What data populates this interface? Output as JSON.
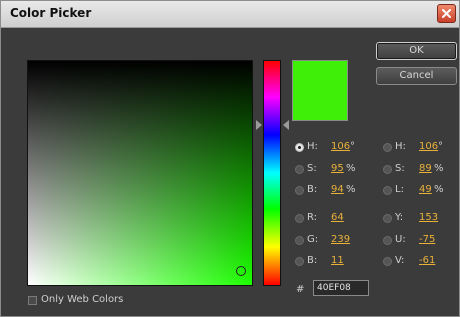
{
  "window": {
    "title": "Color Picker"
  },
  "buttons": {
    "ok": "OK",
    "cancel": "Cancel"
  },
  "color": {
    "hex": "40EF08"
  },
  "hsb": [
    {
      "label": "H:",
      "value": "106",
      "unit": "°",
      "selected": true
    },
    {
      "label": "S:",
      "value": "95",
      "unit": "%",
      "selected": false
    },
    {
      "label": "B:",
      "value": "94",
      "unit": "%",
      "selected": false
    }
  ],
  "rgb": [
    {
      "label": "R:",
      "value": "64",
      "selected": false
    },
    {
      "label": "G:",
      "value": "239",
      "selected": false
    },
    {
      "label": "B:",
      "value": "11",
      "selected": false
    }
  ],
  "hsl": [
    {
      "label": "H:",
      "value": "106",
      "unit": "°",
      "selected": false
    },
    {
      "label": "S:",
      "value": "89",
      "unit": "%",
      "selected": false
    },
    {
      "label": "L:",
      "value": "49",
      "unit": "%",
      "selected": false
    }
  ],
  "yuv": [
    {
      "label": "Y:",
      "value": "153",
      "selected": false
    },
    {
      "label": "U:",
      "value": "-75",
      "selected": false
    },
    {
      "label": "V:",
      "value": "-61",
      "selected": false
    }
  ],
  "hex_prefix": "#",
  "web_colors": {
    "label": "Only Web Colors",
    "checked": false
  },
  "colors": {
    "swatch": "#40ef08",
    "value_text": "#e9b13a",
    "background": "#3b3b3b"
  },
  "icons": {
    "close": "close-icon"
  }
}
